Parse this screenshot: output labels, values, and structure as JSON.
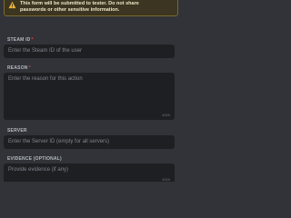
{
  "warning": {
    "line1": "This form will be submitted to tester. Do not share",
    "line2": "passwords or other sensitive information.",
    "icon": "warning-icon",
    "color": "#f0b232"
  },
  "fields": {
    "steam_id": {
      "label": "STEAM ID",
      "required": "*",
      "placeholder": "Enter the Steam ID of the user"
    },
    "reason": {
      "label": "REASON",
      "required": "*",
      "placeholder": "Enter the reason for this action",
      "counter": "4000"
    },
    "server": {
      "label": "SERVER",
      "placeholder": "Enter the Server ID (empty for all servers)"
    },
    "evidence": {
      "label": "EVIDENCE (OPTIONAL)",
      "placeholder": "Provide evidence (if any)",
      "counter": "4000"
    }
  },
  "colors": {
    "background": "#313338",
    "input": "#1e1f22",
    "required": "#f23f43"
  }
}
